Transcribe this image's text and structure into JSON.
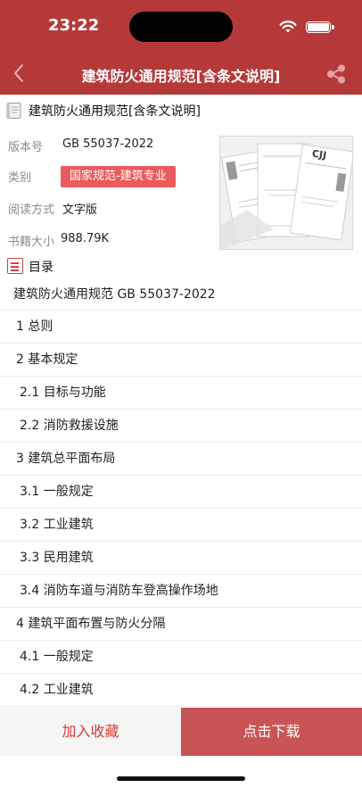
{
  "status": {
    "time": "23:22"
  },
  "nav": {
    "title": "建筑防火通用规范[含条文说明]"
  },
  "book": {
    "title": "建筑防火通用规范[含条文说明]",
    "version_label": "版本号",
    "version_value": "GB 55037-2022",
    "category_label": "类别",
    "category_value": "国家规范-建筑专业",
    "read_label": "阅读方式",
    "read_value": "文字版",
    "size_label": "书籍大小",
    "size_value": "988.79K"
  },
  "cover": {
    "brand_text": "CJJ"
  },
  "toc": {
    "label": "目录",
    "items": [
      "建筑防火通用规范 GB 55037-2022",
      "1 总则",
      "2 基本规定",
      "2.1 目标与功能",
      "2.2 消防救援设施",
      "3 建筑总平面布局",
      "3.1 一般规定",
      "3.2 工业建筑",
      "3.3 民用建筑",
      "3.4 消防车道与消防车登高操作场地",
      "4 建筑平面布置与防火分隔",
      "4.1 一般规定",
      "4.2 工业建筑"
    ]
  },
  "actions": {
    "favorite": "加入收藏",
    "download": "点击下载"
  },
  "colors": {
    "primary": "#b6393a",
    "tag": "#ec5b5b",
    "download_bg": "#c95456",
    "favorite_text": "#d83b3b"
  }
}
